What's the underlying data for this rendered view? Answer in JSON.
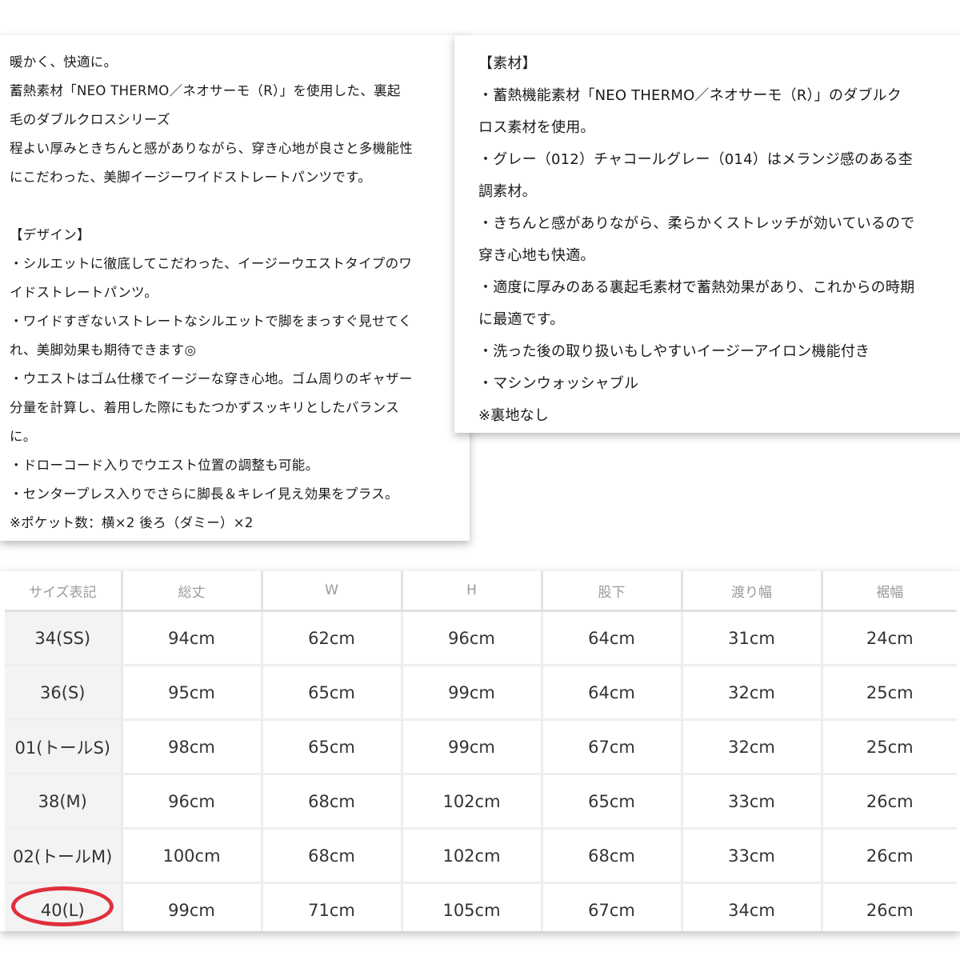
{
  "description": {
    "lines": [
      "暖かく、快適に。",
      "蓄熱素材「NEO THERMO／ネオサーモ（R）」を使用した、裏起",
      "毛のダブルクロスシリーズ",
      "程よい厚みときちんと感がありながら、穿き心地が良さと多機能性",
      "にこだわった、美脚イージーワイドストレートパンツです。",
      "",
      "【デザイン】",
      "・シルエットに徹底してこだわった、イージーウエストタイプのワ",
      "イドストレートパンツ。",
      "・ワイドすぎないストレートなシルエットで脚をまっすぐ見せてく",
      "れ、美脚効果も期待できます◎",
      "・ウエストはゴム仕様でイージーな穿き心地。ゴム周りのギャザー",
      "分量を計算し、着用した際にもたつかずスッキリとしたバランス",
      "に。",
      "・ドローコード入りでウエスト位置の調整も可能。",
      "・センタープレス入りでさらに脚長＆キレイ見え効果をプラス。",
      "※ポケット数：横×2 後ろ（ダミー）×2"
    ]
  },
  "material": {
    "lines": [
      "【素材】",
      "・蓄熱機能素材「NEO THERMO／ネオサーモ（R）」のダブルク",
      "ロス素材を使用。",
      "・グレー（012）チャコールグレー（014）はメランジ感のある杢",
      "調素材。",
      "・きちんと感がありながら、柔らかくストレッチが効いているので",
      "穿き心地も快適。",
      "・適度に厚みのある裏起毛素材で蓄熱効果があり、これからの時期",
      "に最適です。",
      "・洗った後の取り扱いもしやすいイージーアイロン機能付き",
      "・マシンウォッシャブル",
      "※裏地なし"
    ]
  },
  "size_table": {
    "headers": [
      "サイズ表記",
      "総丈",
      "W",
      "H",
      "股下",
      "渡り幅",
      "裾幅"
    ],
    "rows": [
      [
        "34(SS)",
        "94cm",
        "62cm",
        "96cm",
        "64cm",
        "31cm",
        "24cm"
      ],
      [
        "36(S)",
        "95cm",
        "65cm",
        "99cm",
        "64cm",
        "32cm",
        "25cm"
      ],
      [
        "01(トールS)",
        "98cm",
        "65cm",
        "99cm",
        "67cm",
        "32cm",
        "25cm"
      ],
      [
        "38(M)",
        "96cm",
        "68cm",
        "102cm",
        "65cm",
        "33cm",
        "26cm"
      ],
      [
        "02(トールM)",
        "100cm",
        "68cm",
        "102cm",
        "68cm",
        "33cm",
        "26cm"
      ],
      [
        "40(L)",
        "99cm",
        "71cm",
        "105cm",
        "67cm",
        "34cm",
        "26cm"
      ]
    ],
    "highlighted_row": 5,
    "highlight_color": "#e0303c"
  }
}
